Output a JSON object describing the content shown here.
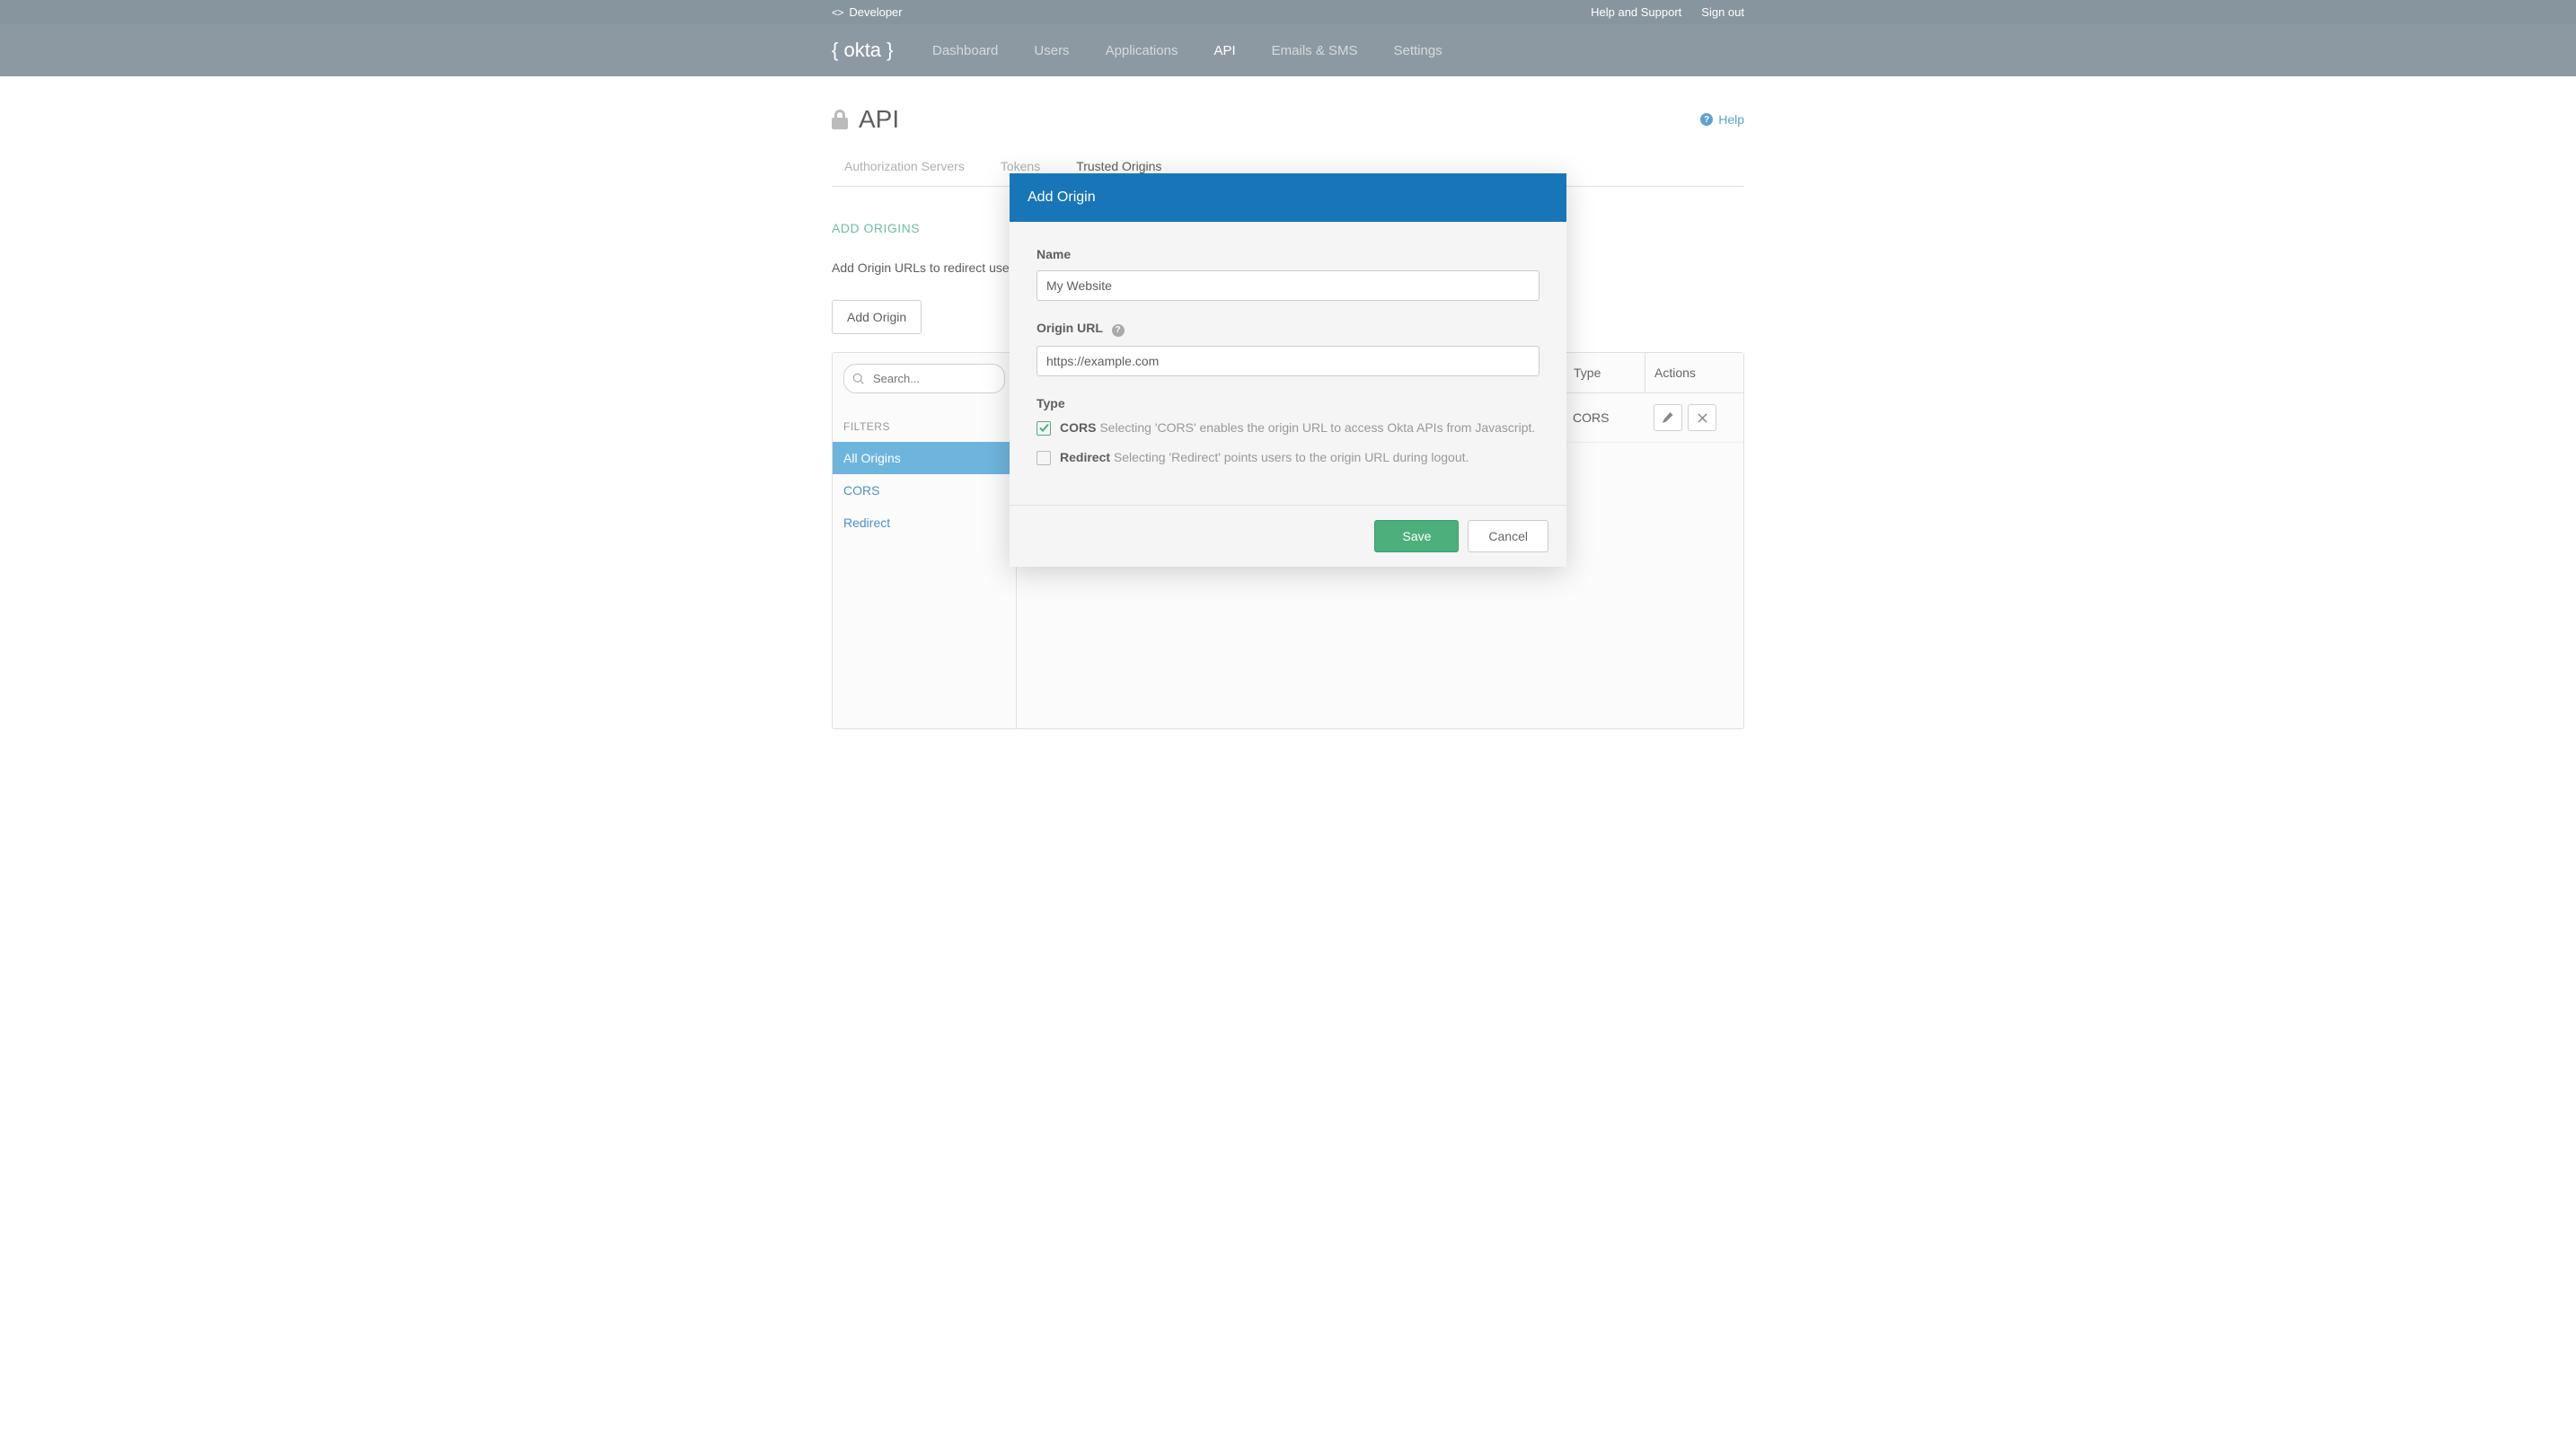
{
  "topbar": {
    "developer_label": "Developer",
    "help_support": "Help and Support",
    "sign_out": "Sign out"
  },
  "nav": {
    "items": [
      {
        "label": "Dashboard",
        "active": false
      },
      {
        "label": "Users",
        "active": false
      },
      {
        "label": "Applications",
        "active": false
      },
      {
        "label": "API",
        "active": true
      },
      {
        "label": "Emails & SMS",
        "active": false
      },
      {
        "label": "Settings",
        "active": false
      }
    ]
  },
  "page": {
    "title": "API",
    "help": "Help"
  },
  "tabs": {
    "items": [
      {
        "label": "Authorization Servers",
        "active": false
      },
      {
        "label": "Tokens",
        "active": false
      },
      {
        "label": "Trusted Origins",
        "active": true
      }
    ]
  },
  "section": {
    "title": "ADD ORIGINS",
    "description": "Add Origin URLs to redirect users",
    "add_button": "Add Origin"
  },
  "search": {
    "placeholder": "Search..."
  },
  "filters": {
    "label": "FILTERS",
    "items": [
      "All Origins",
      "CORS",
      "Redirect"
    ],
    "active_index": 0
  },
  "table": {
    "columns": {
      "type": "Type",
      "actions": "Actions"
    },
    "rows": [
      {
        "type": "CORS"
      }
    ]
  },
  "modal": {
    "title": "Add Origin",
    "name_label": "Name",
    "name_value": "My Website",
    "origin_url_label": "Origin URL",
    "origin_url_value": "https://example.com",
    "type_label": "Type",
    "cors_label": "CORS",
    "cors_desc": "Selecting 'CORS' enables the origin URL to access Okta APIs from Javascript.",
    "cors_checked": true,
    "redirect_label": "Redirect",
    "redirect_desc": "Selecting 'Redirect' points users to the origin URL during logout.",
    "redirect_checked": false,
    "save": "Save",
    "cancel": "Cancel"
  }
}
